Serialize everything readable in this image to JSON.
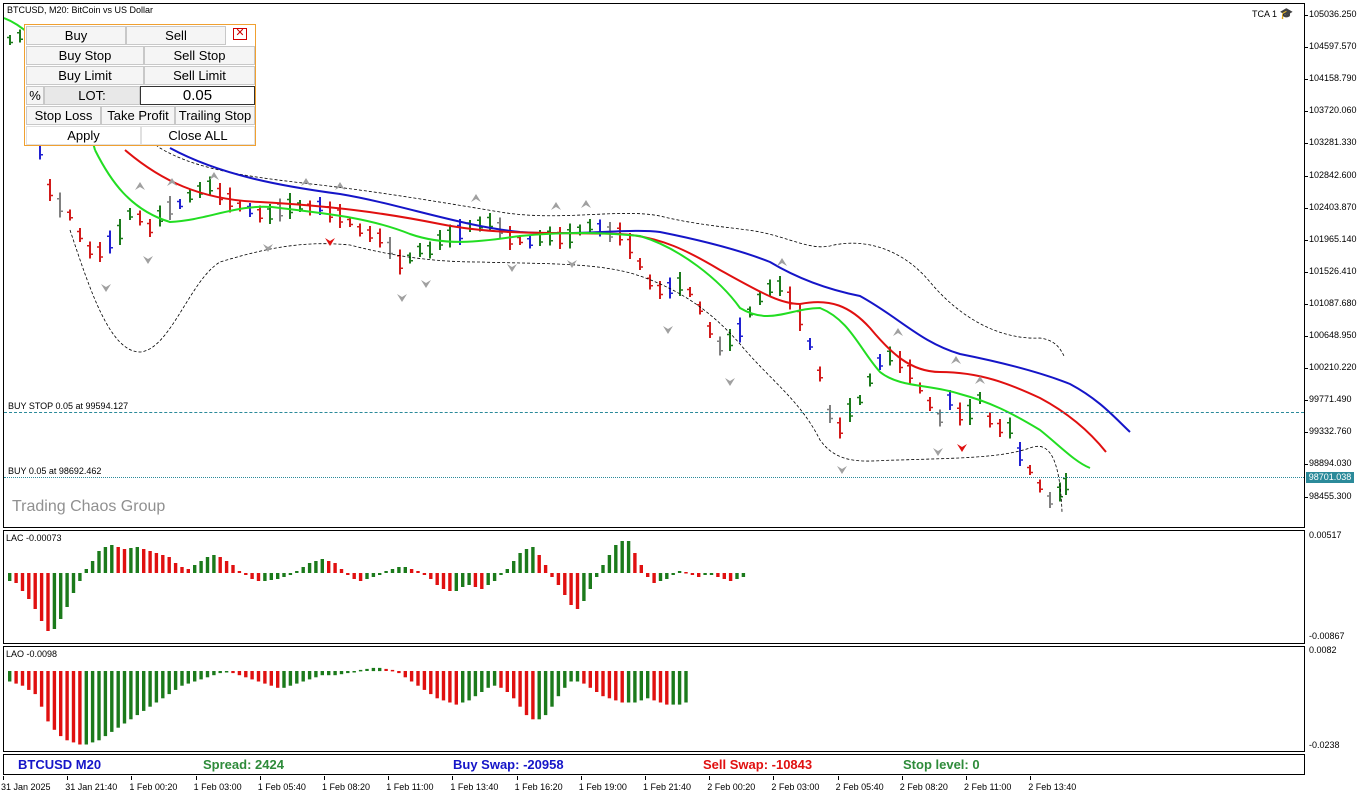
{
  "chart": {
    "title": "BTCUSD, M20:  BitCoin vs US Dollar",
    "indicator_tag": "TCA 1",
    "watermark": "Trading Chaos Group",
    "current_price": "98701.038",
    "buy_stop_label": "BUY STOP 0.05 at 99594.127",
    "buy_label": "BUY 0.05 at 98692.462",
    "price_axis": [
      "105036.250",
      "104597.570",
      "104158.790",
      "103720.060",
      "103281.330",
      "102842.600",
      "102403.870",
      "101965.140",
      "101526.410",
      "101087.680",
      "100648.950",
      "100210.220",
      "99771.490",
      "99332.760",
      "98894.030",
      "98455.300"
    ],
    "colors": {
      "bull_bar": "#1b7a1b",
      "bear_bar": "#d11a1a",
      "squat_bar": "#2020d0",
      "fake_bar": "#808080",
      "line_blue": "#1515c8",
      "line_red": "#e01010",
      "line_green": "#22dd22",
      "level_line": "#2b8a9a"
    }
  },
  "panel": {
    "buy": "Buy",
    "sell": "Sell",
    "close_icon": "close-icon",
    "buy_stop": "Buy Stop",
    "sell_stop": "Sell Stop",
    "buy_limit": "Buy Limit",
    "sell_limit": "Sell Limit",
    "percent": "%",
    "lot_label": "LOT:",
    "lot_value": "0.05",
    "stop_loss": "Stop Loss",
    "take_profit": "Take Profit",
    "trailing_stop": "Trailing Stop",
    "apply": "Apply",
    "close_all": "Close ALL"
  },
  "lac": {
    "label": "LAC -0.00073",
    "axis_top": "0.00517",
    "axis_bottom": "-0.00867",
    "values": [
      -8,
      -10,
      -18,
      -26,
      -36,
      -48,
      -58,
      -56,
      -46,
      -34,
      -20,
      -8,
      4,
      12,
      22,
      26,
      28,
      26,
      24,
      25,
      26,
      24,
      22,
      20,
      18,
      16,
      10,
      6,
      4,
      8,
      12,
      16,
      18,
      16,
      12,
      8,
      2,
      -2,
      -6,
      -8,
      -8,
      -7,
      -6,
      -4,
      -2,
      2,
      6,
      10,
      12,
      14,
      12,
      10,
      4,
      -2,
      -6,
      -8,
      -6,
      -4,
      -2,
      2,
      4,
      6,
      6,
      4,
      2,
      -2,
      -6,
      -12,
      -16,
      -18,
      -18,
      -14,
      -12,
      -14,
      -16,
      -12,
      -8,
      -2,
      4,
      12,
      20,
      24,
      26,
      18,
      8,
      -4,
      -12,
      -22,
      -32,
      -36,
      -28,
      -16,
      -4,
      8,
      18,
      28,
      32,
      32,
      20,
      8,
      -4,
      -10,
      -8,
      -6,
      -2,
      2,
      1,
      -2,
      -4,
      -2,
      -2,
      -4,
      -6,
      -8,
      -6,
      -4
    ]
  },
  "lao": {
    "label": "LAO -0.0098",
    "axis_top": "0.0082",
    "axis_bottom": "-0.0238",
    "values": [
      -10,
      -12,
      -14,
      -18,
      -22,
      -34,
      -48,
      -56,
      -62,
      -66,
      -68,
      -70,
      -70,
      -68,
      -66,
      -62,
      -58,
      -54,
      -50,
      -46,
      -42,
      -38,
      -34,
      -30,
      -26,
      -22,
      -18,
      -14,
      -12,
      -10,
      -8,
      -6,
      -4,
      -2,
      -1,
      -2,
      -4,
      -6,
      -8,
      -10,
      -12,
      -14,
      -16,
      -16,
      -14,
      -12,
      -10,
      -8,
      -6,
      -4,
      -4,
      -4,
      -3,
      -2,
      -1,
      1,
      2,
      3,
      3,
      2,
      1,
      -2,
      -6,
      -10,
      -14,
      -18,
      -22,
      -26,
      -28,
      -30,
      -32,
      -30,
      -28,
      -24,
      -20,
      -16,
      -14,
      -16,
      -20,
      -26,
      -34,
      -42,
      -46,
      -46,
      -42,
      -34,
      -24,
      -16,
      -10,
      -10,
      -12,
      -16,
      -20,
      -24,
      -26,
      -28,
      -30,
      -30,
      -30,
      -28,
      -26,
      -28,
      -30,
      -32,
      -32,
      -32,
      -30
    ]
  },
  "time_axis": [
    "31 Jan 2025",
    "31 Jan 21:40",
    "1 Feb 00:20",
    "1 Feb 03:00",
    "1 Feb 05:40",
    "1 Feb 08:20",
    "1 Feb 11:00",
    "1 Feb 13:40",
    "1 Feb 16:20",
    "1 Feb 19:00",
    "1 Feb 21:40",
    "2 Feb 00:20",
    "2 Feb 03:00",
    "2 Feb 05:40",
    "2 Feb 08:20",
    "2 Feb 11:00",
    "2 Feb 13:40"
  ],
  "status": {
    "symbol": "BTCUSD M20",
    "spread": "Spread: 2424",
    "buy_swap": "Buy Swap: -20958",
    "sell_swap": "Sell Swap: -10843",
    "stop_level": "Stop level: 0",
    "colors": {
      "symbol": "#1515c8",
      "spread": "#2e8b3a",
      "buy_swap": "#1515c8",
      "sell_swap": "#e01010",
      "stop_level": "#2e8b3a"
    }
  }
}
